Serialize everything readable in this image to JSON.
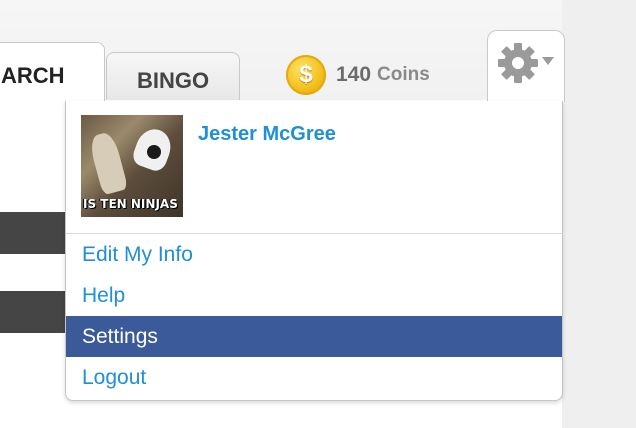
{
  "tabs": [
    {
      "label": "ARCH"
    },
    {
      "label": "BINGO"
    }
  ],
  "coins": {
    "icon_symbol": "$",
    "amount": "140",
    "unit": "Coins"
  },
  "gear": {
    "icon": "gear-icon"
  },
  "profile": {
    "name": "Jester McGree",
    "avatar_caption": "IS TEN NINJAS"
  },
  "menu": {
    "items": [
      {
        "label": "Edit My Info"
      },
      {
        "label": "Help"
      },
      {
        "label": "Settings"
      },
      {
        "label": "Logout"
      }
    ]
  },
  "colors": {
    "link": "#1f8fd6",
    "active_bg": "#3b5a99"
  }
}
